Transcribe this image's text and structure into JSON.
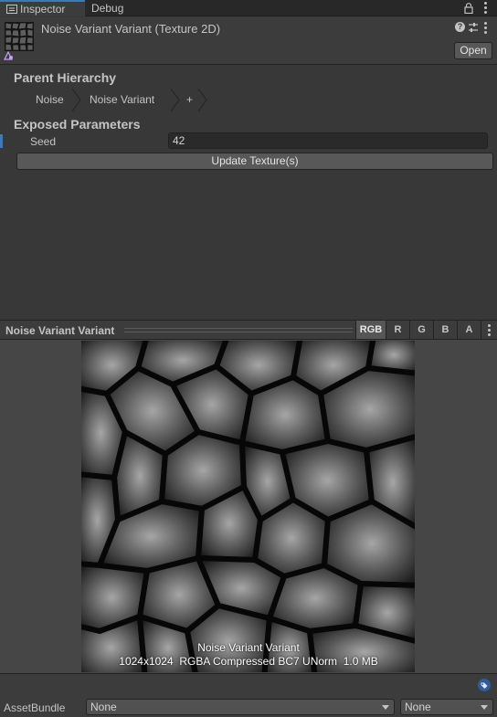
{
  "tabs": {
    "inspector": "Inspector",
    "debug": "Debug"
  },
  "asset": {
    "title": "Noise Variant Variant (Texture 2D)",
    "open_label": "Open"
  },
  "hierarchy": {
    "title": "Parent Hierarchy",
    "crumbs": [
      "Noise",
      "Noise Variant",
      "+"
    ]
  },
  "params": {
    "title": "Exposed Parameters",
    "seed_label": "Seed",
    "seed_value": "42",
    "update_label": "Update Texture(s)"
  },
  "preview": {
    "title": "Noise Variant Variant",
    "channels": [
      "RGB",
      "R",
      "G",
      "B",
      "A"
    ],
    "active_channel": "RGB",
    "tex_name": "Noise Variant Variant",
    "tex_info": "1024x1024  RGBA Compressed BC7 UNorm  1.0 MB"
  },
  "footer": {
    "assetbundle_label": "AssetBundle",
    "bundle_value": "None",
    "variant_value": "None"
  },
  "colors": {
    "accent": "#3a79bb",
    "background": "#383838",
    "panel": "#3c3c3c"
  },
  "icons": [
    "inspector-tab-icon",
    "lock-icon",
    "kebab-menu-icon",
    "help-icon",
    "settings-icon",
    "tag-icon",
    "chevron-down-icon"
  ]
}
